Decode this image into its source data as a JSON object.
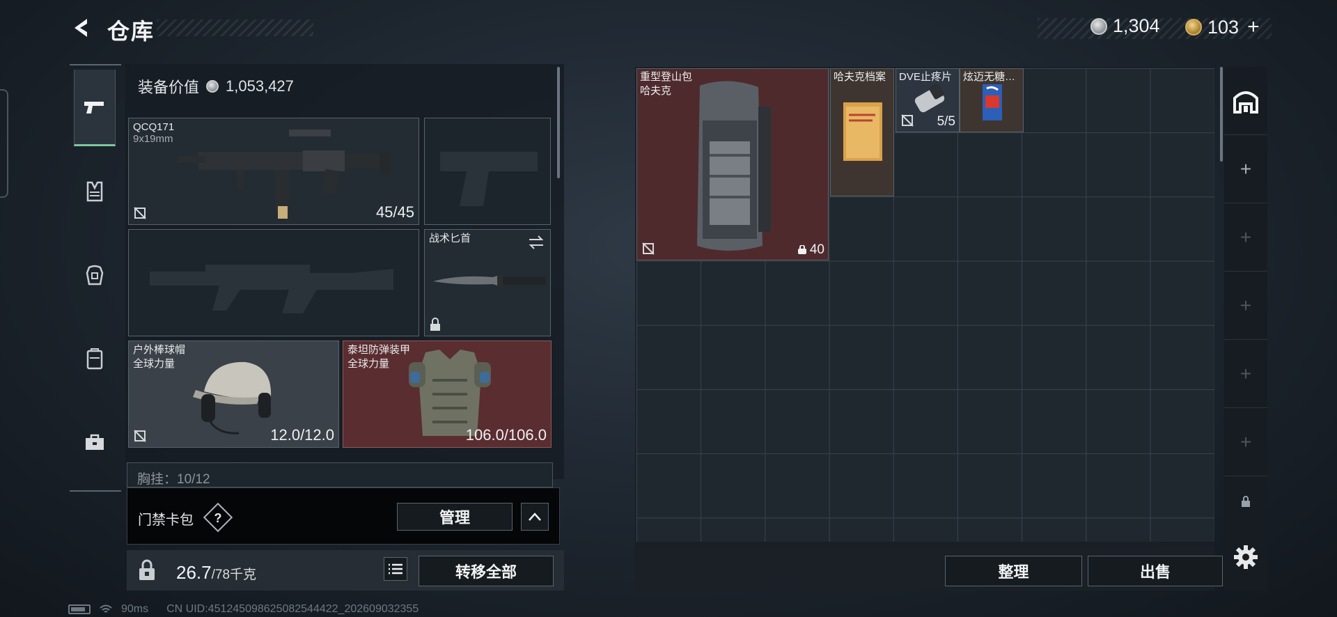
{
  "header": {
    "title": "仓库",
    "currency_silver": "1,304",
    "currency_gold": "103",
    "plus": "+"
  },
  "equipment": {
    "value_label": "装备价值",
    "value": "1,053,427",
    "primary_weapon": {
      "name": "QCQ171",
      "caliber": "9x19mm",
      "ammo": "45/45"
    },
    "knife": {
      "name": "战术匕首"
    },
    "helmet": {
      "name": "户外棒球帽",
      "brand": "全球力量",
      "durability": "12.0/12.0"
    },
    "armor": {
      "name": "泰坦防弹装甲",
      "brand": "全球力量",
      "durability": "106.0/106.0"
    },
    "chest_rig_partial": "胸挂：10/12",
    "keycard": {
      "label": "门禁卡包",
      "help": "?",
      "manage": "管理"
    },
    "weight": {
      "current": "26.7",
      "max": "/78千克"
    },
    "transfer_all": "转移全部"
  },
  "stash": {
    "items": [
      {
        "name": "重型登山包",
        "brand": "哈夫克",
        "count": "40"
      },
      {
        "name": "哈夫克档案"
      },
      {
        "name": "DVE止疼片",
        "count": "5/5"
      },
      {
        "name": "炫迈无糖…"
      }
    ],
    "sort": "整理",
    "sell": "出售"
  },
  "status_bar": {
    "ping": "90ms",
    "uid": "CN UID:451245098625082544422_202609032355"
  },
  "colors": {
    "accent_green": "#7fc7a0",
    "rarity_red": "#5a2d30",
    "rarity_gold": "#3e3530"
  }
}
